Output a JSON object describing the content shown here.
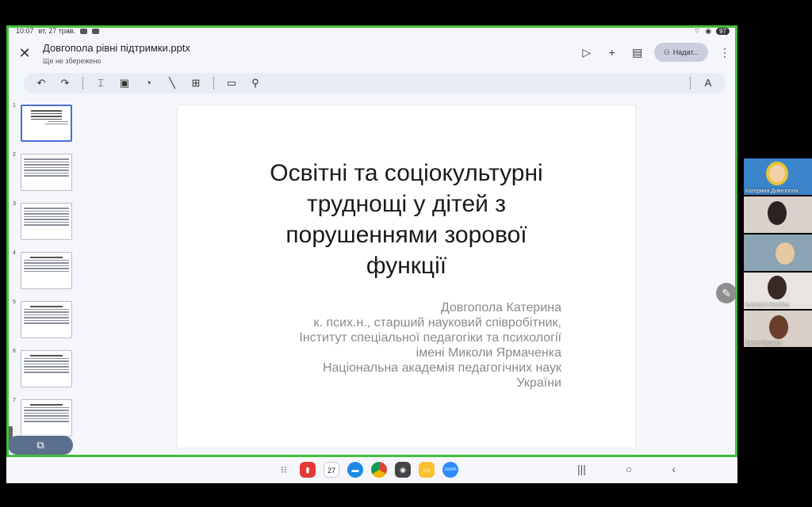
{
  "status": {
    "time": "10:07",
    "date": "вт, 27 трав.",
    "battery": "97"
  },
  "header": {
    "close_glyph": "✕",
    "title": "Довгопола рівні підтримки.pptx",
    "save_status": "Ще не збережено",
    "share_label": "Надат...",
    "actions": [
      "play-icon",
      "add-icon",
      "comment-icon",
      "share-person-icon",
      "more-vert-icon"
    ]
  },
  "toolbar": {
    "buttons": [
      "undo-icon",
      "redo-icon",
      "text-box-icon",
      "image-icon",
      "shapes-icon",
      "line-icon",
      "table-icon",
      "layout-icon",
      "paint-format-icon",
      "text-format-icon"
    ]
  },
  "filmstrip": {
    "slides": [
      "1",
      "2",
      "3",
      "4",
      "5",
      "6",
      "7"
    ],
    "active": "1",
    "new_slide_glyph": "⧉"
  },
  "slide": {
    "title_lines": [
      "Освітні та соціокультурні",
      "труднощі у дітей з",
      "порушеннями зорової",
      "функції"
    ],
    "subtitle_lines": [
      "Довгопола Катерина",
      "к. псих.н., старший науковий співробітник,",
      "Інститут спеціальної педагогіки та психології",
      "імені Миколи Ярмаченка",
      "Національна академія педагогічних наук",
      "України"
    ]
  },
  "participants": [
    {
      "name": "Катерина Довгопола"
    },
    {
      "name": ""
    },
    {
      "name": ""
    },
    {
      "name": "Kateryna Kuchina"
    },
    {
      "name": "Ірина Пущина"
    }
  ],
  "dock": {
    "calendar_day": "27",
    "zoom_label": "zoom",
    "nav": [
      "|||",
      "○",
      "‹"
    ]
  },
  "colors": {
    "share_border": "#3fbf3a",
    "accent": "#4a6fd0"
  }
}
